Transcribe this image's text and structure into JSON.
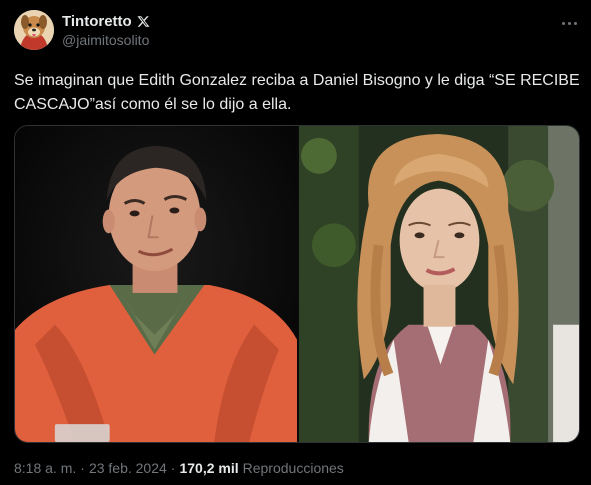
{
  "author": {
    "display_name": "Tintoretto",
    "handle": "@jaimitosolito",
    "avatar_icon": "dog-avatar-icon",
    "badge_icon": "x-logo-icon"
  },
  "tweet": {
    "text": "Se imaginan que Edith Gonzalez reciba a Daniel Bisogno y le diga “SE RECIBE CASCAJO”así como él se lo dijo a ella."
  },
  "media": {
    "left_photo": "man-in-orange-blazer-photo",
    "right_photo": "woman-with-blonde-hair-photo"
  },
  "meta": {
    "time": "8:18 a. m.",
    "separator": "·",
    "date": "23 feb. 2024",
    "views_count": "170,2 mil",
    "views_label": "Reproducciones"
  },
  "colors": {
    "background": "#000000",
    "primary_text": "#e7e9ea",
    "secondary_text": "#71767b",
    "border": "#2f3336"
  }
}
